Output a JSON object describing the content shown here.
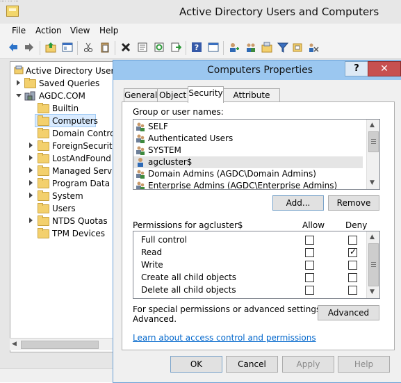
{
  "window": {
    "title": "Active Directory Users and Computers",
    "top_fragment": "···· ··· ···"
  },
  "menu": [
    "File",
    "Action",
    "View",
    "Help"
  ],
  "toolbar_icons": [
    "back-icon",
    "forward-icon",
    "up-folder-icon",
    "show-hide-tree-icon",
    "cut-icon",
    "paste-icon",
    "delete-icon",
    "properties-icon",
    "refresh-icon",
    "export-icon",
    "help-icon",
    "console-icon",
    "user-icon",
    "group-icon",
    "ou-icon",
    "filter-icon",
    "add-to-group-icon",
    "delegate-icon"
  ],
  "tree": {
    "root": "Active Directory Users a",
    "items": [
      {
        "label": "Saved Queries"
      },
      {
        "label": "AGDC.COM"
      },
      {
        "label": "Builtin"
      },
      {
        "label": "Computers"
      },
      {
        "label": "Domain Controll"
      },
      {
        "label": "ForeignSecurityP"
      },
      {
        "label": "LostAndFound"
      },
      {
        "label": "Managed Service"
      },
      {
        "label": "Program Data"
      },
      {
        "label": "System"
      },
      {
        "label": "Users"
      },
      {
        "label": "NTDS Quotas"
      },
      {
        "label": "TPM Devices"
      }
    ]
  },
  "dialog": {
    "title": "Computers Properties",
    "help_label": "?",
    "close_label": "✕",
    "tabs": [
      "General",
      "Object",
      "Security",
      "Attribute Editor"
    ],
    "active_tab": "Security",
    "group_label": "Group or user names:",
    "principals": [
      {
        "name": "SELF",
        "selected": false
      },
      {
        "name": "Authenticated Users",
        "selected": false
      },
      {
        "name": "SYSTEM",
        "selected": false
      },
      {
        "name": "agcluster$",
        "selected": true
      },
      {
        "name": "Domain Admins (AGDC\\Domain Admins)",
        "selected": false
      },
      {
        "name": "Enterprise Admins (AGDC\\Enterprise Admins)",
        "selected": false
      }
    ],
    "add_label": "Add...",
    "remove_label": "Remove",
    "permissions_label": "Permissions for agcluster$",
    "allow_header": "Allow",
    "deny_header": "Deny",
    "permissions": [
      {
        "name": "Full control",
        "allow": false,
        "deny": false
      },
      {
        "name": "Read",
        "allow": false,
        "deny": true
      },
      {
        "name": "Write",
        "allow": false,
        "deny": false
      },
      {
        "name": "Create all child objects",
        "allow": false,
        "deny": false
      },
      {
        "name": "Delete all child objects",
        "allow": false,
        "deny": false
      }
    ],
    "special_text_1": "For special permissions or advanced settings, click",
    "special_text_2": "Advanced.",
    "advanced_label": "Advanced",
    "learn_link": "Learn about access control and permissions",
    "ok_label": "OK",
    "cancel_label": "Cancel",
    "apply_label": "Apply",
    "help_button_label": "Help"
  },
  "colors": {
    "dialog_title_bar": "#9bc7f0",
    "close_button": "#c75050",
    "link": "#0066cc"
  }
}
